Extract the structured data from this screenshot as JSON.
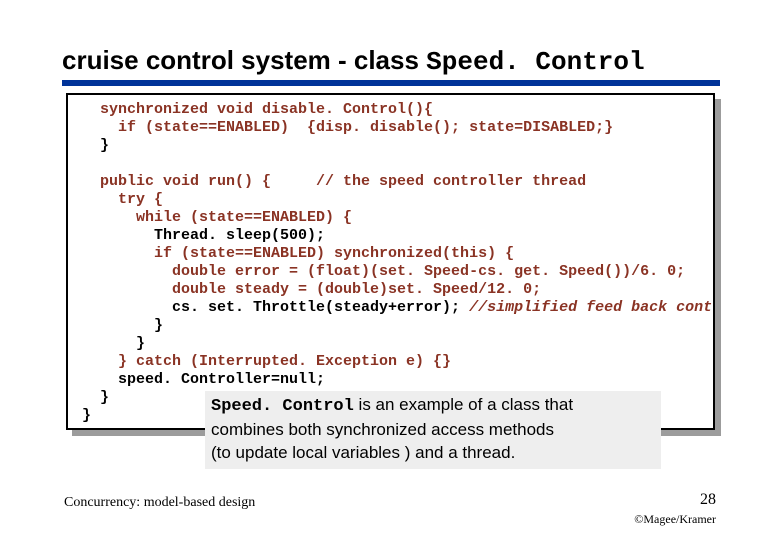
{
  "title_plain": "cruise control system - class ",
  "title_mono": "Speed. Control",
  "code": {
    "l1a": "  synchronized void disable. Control(){",
    "l2a": "    if (state==ENABLED)  {disp. disable(); state=DISABLED;}",
    "l3a": "  }",
    "l4": "",
    "l5a": "  public void run() {     // the speed controller thread",
    "l6a": "    try {",
    "l7a": "      while (state==ENABLED) {",
    "l8": "        Thread. sleep(500);",
    "l9a": "        if (state==ENABLED) synchronized(this) {",
    "l10": "          double error = (float)(set. Speed-cs. get. Speed())/6. 0;",
    "l11": "          double steady = (double)set. Speed/12. 0;",
    "l12a": "          cs. set. Throttle(steady+error); ",
    "l12b": "//simplified feed back control",
    "l13": "        }",
    "l14": "      }",
    "l15a": "    } catch (Interrupted. Exception e) {}",
    "l16": "    speed. Controller=null;",
    "l17": "  }",
    "l18": "}"
  },
  "note_mono": "Speed. Control",
  "note_rest1": " is an example of a class that",
  "note_line2": "combines both synchronized access methods",
  "note_line3": "(to update local variables ) and a thread.",
  "footer_left": "Concurrency: model-based design",
  "page_number": "28",
  "credit": "©Magee/Kramer"
}
